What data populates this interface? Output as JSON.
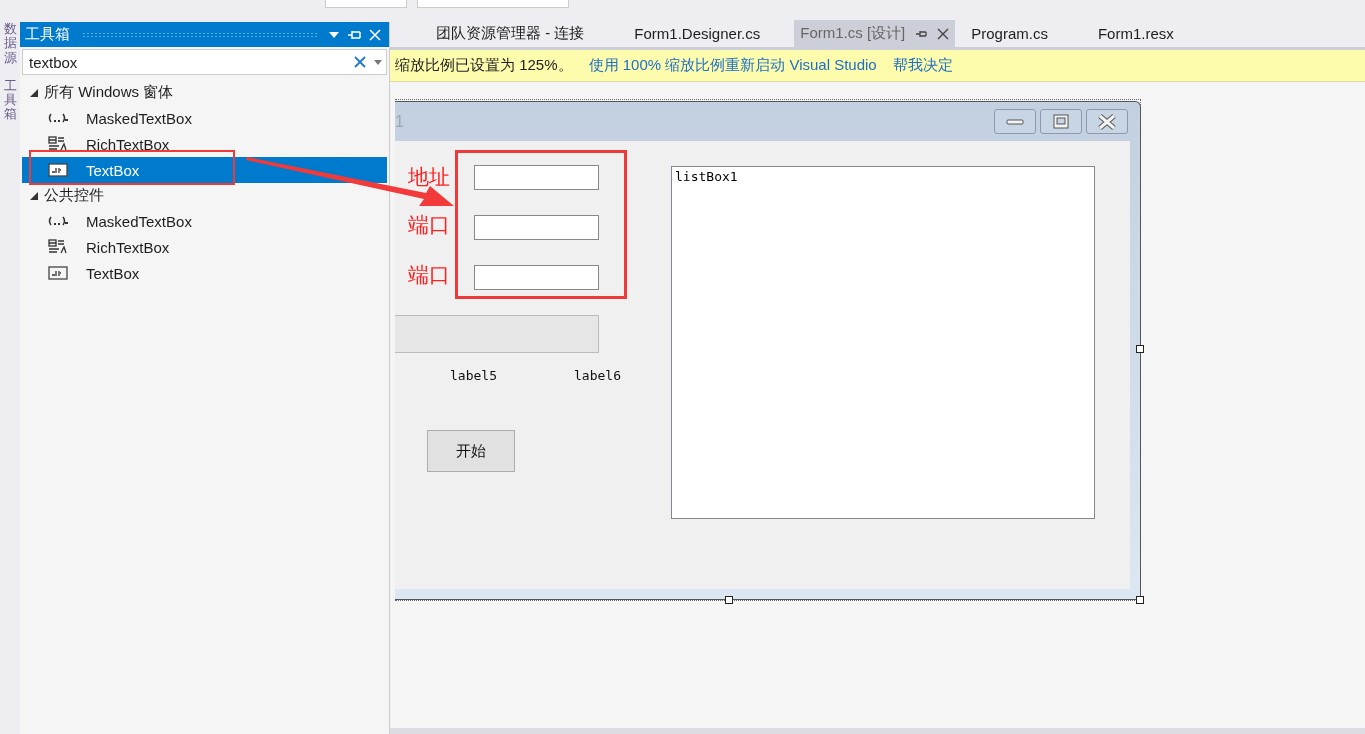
{
  "side_tabs": [
    "数据源",
    "工具箱"
  ],
  "toolbox": {
    "title": "工具箱",
    "search": {
      "value": "textbox"
    },
    "groups": [
      {
        "label": "所有 Windows 窗体",
        "expanded": true,
        "items": [
          {
            "label": "MaskedTextBox",
            "kind": "masked",
            "selected": false
          },
          {
            "label": "RichTextBox",
            "kind": "rich",
            "selected": false
          },
          {
            "label": "TextBox",
            "kind": "textbox",
            "selected": true
          }
        ]
      },
      {
        "label": "公共控件",
        "expanded": true,
        "items": [
          {
            "label": "MaskedTextBox",
            "kind": "masked",
            "selected": false
          },
          {
            "label": "RichTextBox",
            "kind": "rich",
            "selected": false
          },
          {
            "label": "TextBox",
            "kind": "textbox",
            "selected": false
          }
        ]
      }
    ]
  },
  "doc_tabs": [
    {
      "label": "团队资源管理器 - 连接",
      "selected": false
    },
    {
      "label": "Form1.Designer.cs",
      "selected": false
    },
    {
      "label": "Form1.cs [设计]",
      "selected": true
    },
    {
      "label": "Program.cs",
      "selected": false
    },
    {
      "label": "Form1.resx",
      "selected": false
    }
  ],
  "info_bar": {
    "message": "缩放比例已设置为 125%。",
    "links": [
      "使用 100% 缩放比例重新启动 Visual Studio",
      "帮我决定"
    ]
  },
  "form": {
    "title": "1",
    "progress": {
      "level": 0
    },
    "rows": [
      {
        "label": "地址"
      },
      {
        "label": "端口"
      },
      {
        "label": "端口"
      }
    ],
    "labels": [
      "label5",
      "label6"
    ],
    "button": "开始",
    "listbox": "listBox1"
  }
}
